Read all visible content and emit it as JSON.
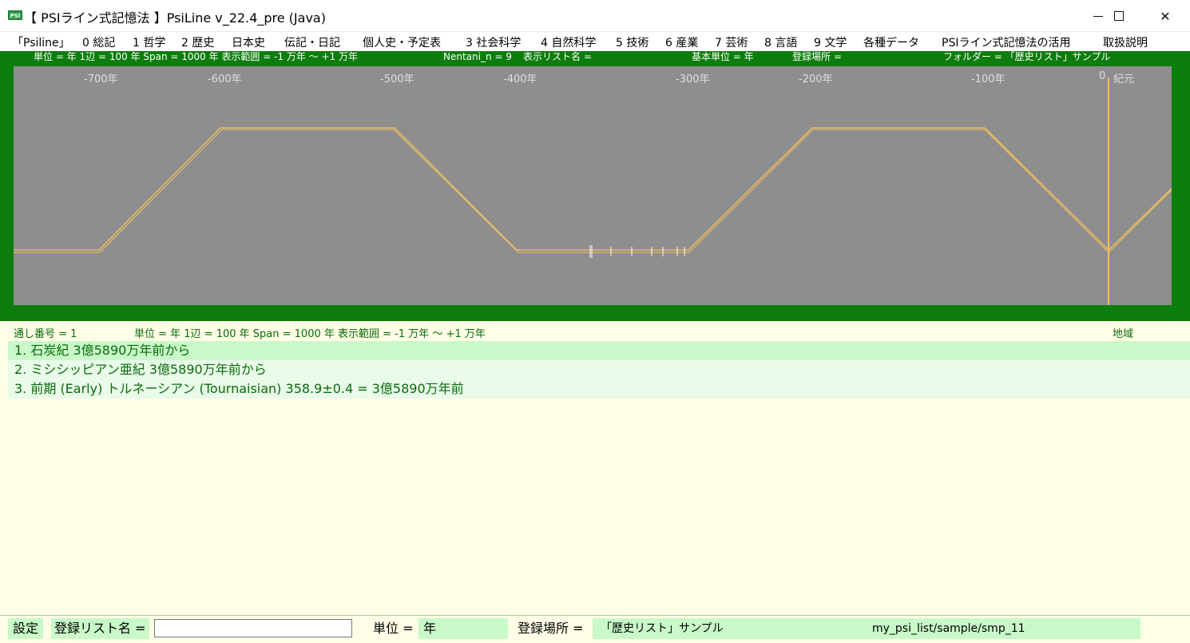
{
  "window": {
    "icon_text": "PSI",
    "title": "【 PSIライン式記憶法 】PsiLine v_22.4_pre (Java)"
  },
  "menu": [
    "「Psiline」",
    "0 総記",
    "1 哲学",
    "2 歴史",
    "日本史",
    "伝記・日記",
    "個人史・予定表",
    "3 社会科学",
    "4 自然科学",
    "5 技術",
    "6 産業",
    "7 芸術",
    "8 言語",
    "9 文学",
    "各種データ",
    "PSIライン式記憶法の活用",
    "取扱説明"
  ],
  "chart_info": {
    "unit": "単位 = 年  1辺 = 100 年  Span = 1000 年  表示範囲 = -1 万年 ～ +1 万年",
    "nentani": "Nentani_n = 9",
    "list_name": "表示リスト名 =",
    "base_unit": "基本単位 = 年",
    "location": "登録場所 =",
    "folder": "フォルダー = 「歴史リスト」サンプル"
  },
  "timeline": {
    "tick_labels": [
      "-700年",
      "-600年",
      "-500年",
      "-400年",
      "-300年",
      "-200年",
      "-100年",
      "0",
      "紀元"
    ],
    "line_color": "#f5c060",
    "plot_bg": "#8e8e8e",
    "frame_color": "#0d7d0d"
  },
  "status": {
    "serial": "通し番号 = 1",
    "unit": "単位 = 年  1辺 = 100 年  Span = 1000 年  表示範囲 = -1 万年 ～ +1 万年",
    "region": "地域"
  },
  "items": [
    "1. 石炭紀 3億5890万年前から",
    "2. ミシシッピアン亜紀 3億5890万年前から",
    "3. 前期 (Early) トルネーシアン (Tournaisian) 358.9±0.4 = 3億5890万年前"
  ],
  "bottom": {
    "settings": "設定",
    "list_name_label": "登録リスト名 =",
    "list_name_value": "",
    "unit_label": "単位 =",
    "unit_value": "年",
    "location_label": "登録場所 =",
    "location_value": "「歴史リスト」サンプル",
    "path": "my_psi_list/sample/smp_11"
  }
}
